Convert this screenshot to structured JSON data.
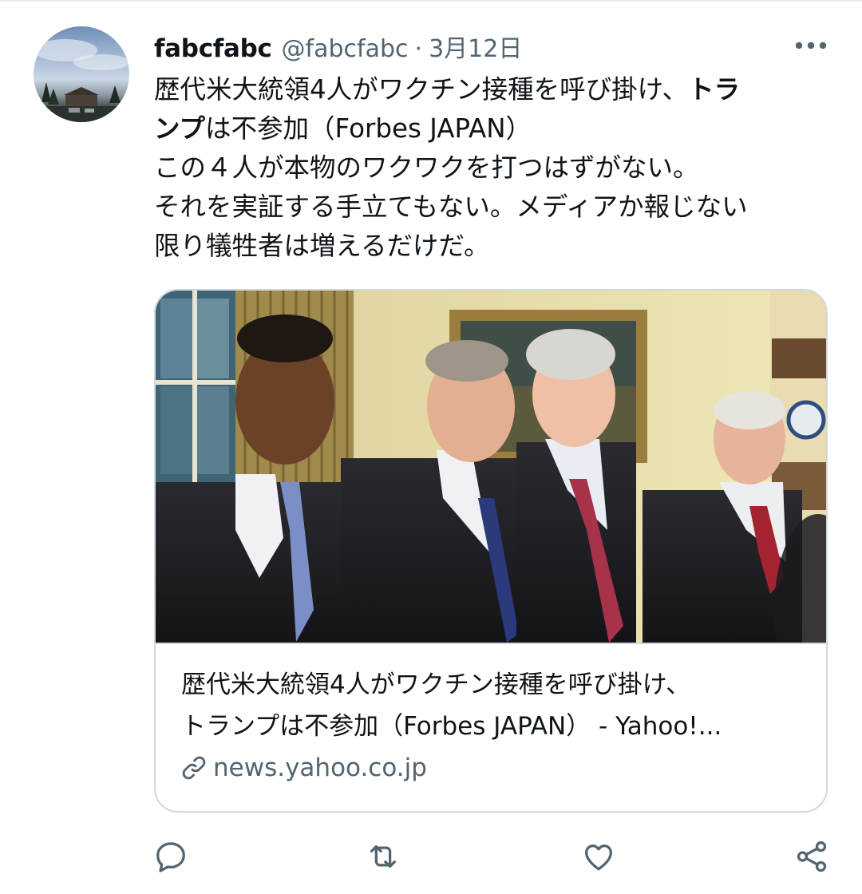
{
  "tweet": {
    "display_name": "fabcfabc",
    "handle": "@fabcfabc",
    "separator": "·",
    "date": "3月12日",
    "text_lines": [
      {
        "pre": "歴代米大統領4人がワクチン接種を呼び掛け、",
        "bold": "トラ",
        "post": ""
      },
      {
        "pre": "",
        "bold": "ンプ",
        "post": "は不参加（Forbes JAPAN）"
      },
      {
        "pre": "この４人が本物のワクワクを打つはずがない。",
        "bold": "",
        "post": ""
      },
      {
        "pre": "それを実証する手立てもない。メディアか報じない",
        "bold": "",
        "post": ""
      },
      {
        "pre": "限り犠牲者は増えるだけだ。",
        "bold": "",
        "post": ""
      }
    ]
  },
  "card": {
    "title_line1": "歴代米大統領4人がワクチン接種を呼び掛け、",
    "title_line2": "トランプは不参加（Forbes JAPAN） - Yahoo!...",
    "domain": "news.yahoo.co.jp",
    "image_alt": "Four presidents standing in the Oval Office"
  },
  "actions": {
    "icons": [
      "reply-icon",
      "retweet-icon",
      "like-icon",
      "share-icon"
    ]
  },
  "colors": {
    "text": "#0f1419",
    "secondary": "#536471",
    "border": "#cfd9de"
  }
}
